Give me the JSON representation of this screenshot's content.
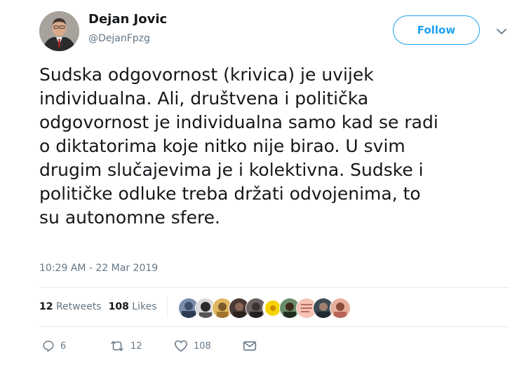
{
  "author": {
    "name": "Dejan Jovic",
    "handle": "@DejanFpzg"
  },
  "follow_button": {
    "label": "Follow"
  },
  "tweet": {
    "lines": [
      "Sudska odgovornost (krivica) je uvijek",
      "individualna. Ali, društvena i politička",
      "odgovornost je individualna samo kad se radi",
      "o diktatorima koje nitko nije birao. U svim",
      "drugim slučajevima je i kolektivna. Sudske i",
      "političke odluke treba držati odvojenima, to",
      "su autonomne sfere."
    ],
    "timestamp": "10:29 AM - 22 Mar 2019"
  },
  "stats": {
    "retweets_count": "12",
    "retweets_label": "Retweets",
    "likes_count": "108",
    "likes_label": "Likes"
  },
  "likers": [
    {
      "icon": "liker-avatar",
      "color": "#5a6a88"
    },
    {
      "icon": "liker-avatar",
      "color": "#3b3b3b"
    },
    {
      "icon": "liker-avatar",
      "color": "#c9a24a"
    },
    {
      "icon": "liker-avatar",
      "color": "#6e3b2a"
    },
    {
      "icon": "liker-avatar",
      "color": "#5b4a45"
    },
    {
      "icon": "liker-avatar",
      "color": "#f5d300"
    },
    {
      "icon": "liker-avatar",
      "color": "#7a5a3e"
    },
    {
      "icon": "liker-avatar",
      "color": "#f2b7a8"
    },
    {
      "icon": "liker-avatar",
      "color": "#2f3e48"
    },
    {
      "icon": "liker-avatar",
      "color": "#c07a66"
    }
  ],
  "actions": {
    "replies": "6",
    "retweets": "12",
    "likes": "108"
  },
  "colors": {
    "accent": "#1da1f2",
    "text": "#14171a",
    "secondary": "#657786",
    "divider": "#e6ecf0"
  }
}
